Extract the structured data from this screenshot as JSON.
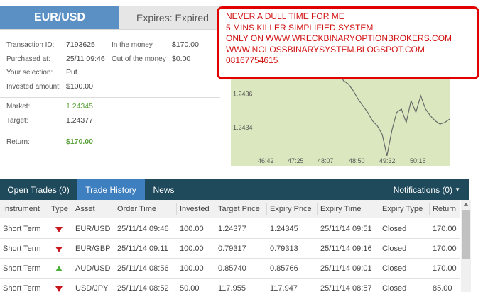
{
  "header": {
    "asset": "EUR/USD",
    "expires_label": "Expires:",
    "expires_value": "Expired"
  },
  "details": {
    "transaction_id_label": "Transaction ID:",
    "transaction_id": "7193625",
    "in_the_money_label": "In the money",
    "in_the_money": "$170.00",
    "purchased_label": "Purchased at:",
    "purchased": "25/11 09:46",
    "out_of_money_label": "Out of the money",
    "out_of_money": "$0.00",
    "selection_label": "Your selection:",
    "selection": "Put",
    "invested_label": "Invested amount:",
    "invested": "$100.00",
    "market_label": "Market:",
    "market": "1.24345",
    "target_label": "Target:",
    "target": "1.24377",
    "return_label": "Return:",
    "return": "$170.00"
  },
  "annotation": {
    "line1": "NEVER A DULL TIME FOR ME",
    "line2": "5 MINS KILLER SIMPLIFIED SYSTEM",
    "line3": "ONLY ON WWW.WRECKBINARYOPTIONBROKERS.COM",
    "line4": "WWW.NOLOSSBINARYSYSTEM.BLOGSPOT.COM",
    "line5": "08167754615"
  },
  "chart_data": {
    "type": "line",
    "x_ticks": [
      "46:42",
      "47:25",
      "48:07",
      "48:50",
      "49:32",
      "50:15"
    ],
    "y_ticks": [
      "1.2436",
      "1.2434"
    ],
    "series": [
      {
        "values": [
          1.24383,
          1.24381,
          1.24379,
          1.24377,
          1.24375,
          1.24373,
          1.24368,
          1.24366,
          1.24362,
          1.24357,
          1.24353,
          1.24349,
          1.24344,
          1.24341,
          1.24336,
          1.24323,
          1.24338,
          1.24349,
          1.24351,
          1.24343,
          1.24356,
          1.24349,
          1.24359,
          1.24351,
          1.24347,
          1.24344,
          1.24342,
          1.24343,
          1.24345
        ]
      }
    ],
    "background": "#dbe8bf",
    "line_color": "#6a6a6a"
  },
  "tabs": {
    "open_trades": "Open Trades (0)",
    "trade_history": "Trade History",
    "news": "News",
    "notifications": "Notifications (0)"
  },
  "table": {
    "headers": [
      "Instrument",
      "Type",
      "Asset",
      "Order Time",
      "Invested",
      "Target Price",
      "Expiry Price",
      "Expiry Time",
      "Expiry Type",
      "Return"
    ],
    "rows": [
      {
        "instrument": "Short Term",
        "type": "put",
        "asset": "EUR/USD",
        "order_time": "25/11/14 09:46",
        "invested": "100.00",
        "target": "1.24377",
        "expiry_price": "1.24345",
        "expiry_time": "25/11/14 09:51",
        "expiry_type": "Closed",
        "return": "170.00"
      },
      {
        "instrument": "Short Term",
        "type": "put",
        "asset": "EUR/GBP",
        "order_time": "25/11/14 09:11",
        "invested": "100.00",
        "target": "0.79317",
        "expiry_price": "0.79313",
        "expiry_time": "25/11/14 09:16",
        "expiry_type": "Closed",
        "return": "170.00"
      },
      {
        "instrument": "Short Term",
        "type": "call",
        "asset": "AUD/USD",
        "order_time": "25/11/14 08:56",
        "invested": "100.00",
        "target": "0.85740",
        "expiry_price": "0.85766",
        "expiry_time": "25/11/14 09:01",
        "expiry_type": "Closed",
        "return": "170.00"
      },
      {
        "instrument": "Short Term",
        "type": "put",
        "asset": "USD/JPY",
        "order_time": "25/11/14 08:52",
        "invested": "50.00",
        "target": "117.955",
        "expiry_price": "117.947",
        "expiry_time": "25/11/14 08:57",
        "expiry_type": "Closed",
        "return": "85.00"
      }
    ]
  },
  "colors": {
    "accent_blue": "#3e7fc0",
    "dark_bar": "#1e4a5c",
    "green": "#5aa23a",
    "red": "#c8161d"
  }
}
